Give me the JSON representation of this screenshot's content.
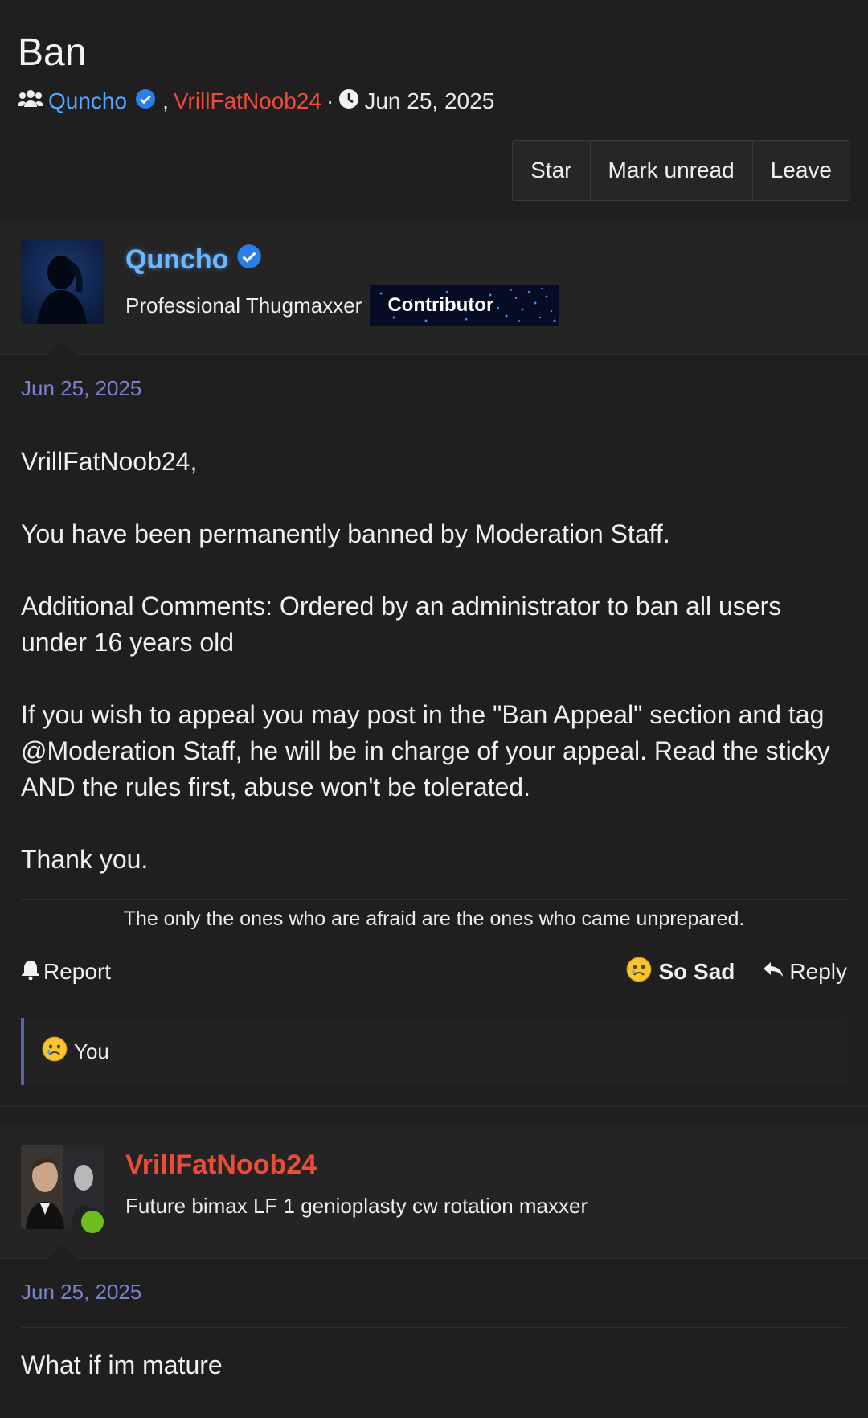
{
  "thread": {
    "title": "Ban",
    "participant_1": "Quncho",
    "comma": ",",
    "participant_2": "VrillFatNoob24",
    "separator": "·",
    "date": "Jun 25, 2025"
  },
  "actions": {
    "star": "Star",
    "mark_unread": "Mark unread",
    "leave": "Leave"
  },
  "messages": [
    {
      "author": "Quncho",
      "user_title": "Professional Thugmaxxer",
      "badge": "Contributor",
      "date": "Jun 25, 2025",
      "paragraphs": [
        "VrillFatNoob24,",
        "You have been permanently banned by Moderation Staff.",
        "Additional Comments: Ordered by an administrator to ban all users under 16 years old",
        "If you wish to appeal you may post in the \"Ban Appeal\" section and tag @Moderation Staff, he will be in charge of your appeal. Read the sticky AND the rules first, abuse won't be tolerated.",
        "Thank you."
      ],
      "signature": "The only the ones who are afraid are the ones who came unprepared.",
      "report_label": "Report",
      "reaction_label": "So Sad",
      "reply_label": "Reply",
      "reacted_by": "You"
    },
    {
      "author": "VrillFatNoob24",
      "user_title": "Future bimax LF 1 genioplasty cw rotation maxxer",
      "date": "Jun 25, 2025",
      "paragraphs": [
        "What if im mature"
      ]
    }
  ],
  "icons": {
    "participants": "users-icon",
    "verified": "verified-check-icon",
    "clock": "clock-icon",
    "report": "bell-icon",
    "reaction": "sad-face-emoji-icon",
    "reply": "reply-arrow-icon"
  },
  "colors": {
    "background": "#1f1f1f",
    "link_blue": "#58a6ff",
    "username_red": "#f04a3a",
    "date_purple": "#7a82c9",
    "verified_blue": "#2b7de9",
    "online_green": "#6cbf1a"
  }
}
